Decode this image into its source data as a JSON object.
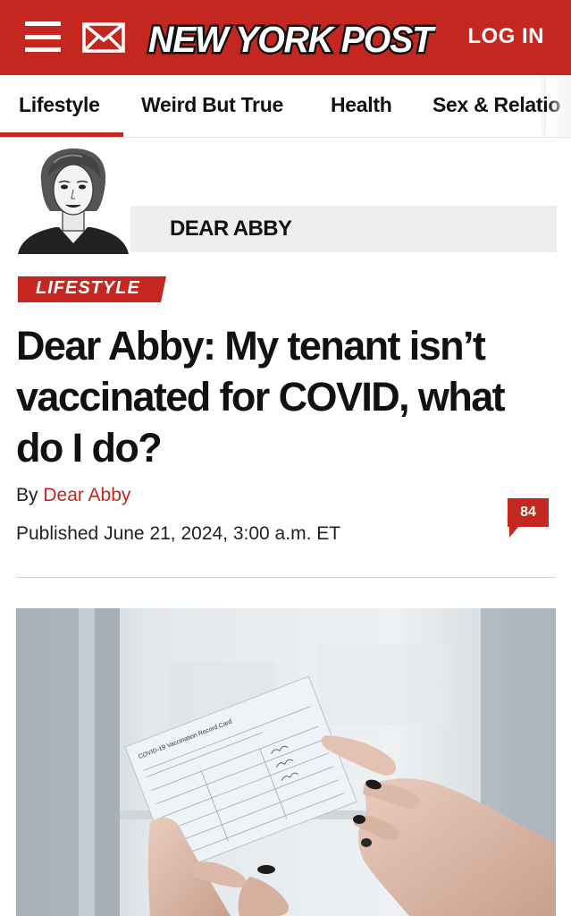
{
  "header": {
    "logo_text": "NEW YORK POST",
    "login_label": "LOG IN",
    "brand_color": "#c4271f",
    "icons": [
      "menu-icon",
      "mail-icon"
    ]
  },
  "sections": [
    {
      "label": "Lifestyle",
      "active": true
    },
    {
      "label": "Weird But True",
      "active": false
    },
    {
      "label": "Health",
      "active": false
    },
    {
      "label": "Sex & Relatio",
      "active": false
    }
  ],
  "column": {
    "name": "DEAR ABBY"
  },
  "article": {
    "tag": "LIFESTYLE",
    "headline": "Dear Abby: My tenant isn’t vaccinated for COVID, what do I do?",
    "by_prefix": "By",
    "author": "Dear Abby",
    "published": "Published June 21, 2024, 3:00 a.m. ET",
    "comment_count": "84"
  },
  "hero_image": {
    "card_title": "COVID-19 Vaccination Record Card"
  }
}
